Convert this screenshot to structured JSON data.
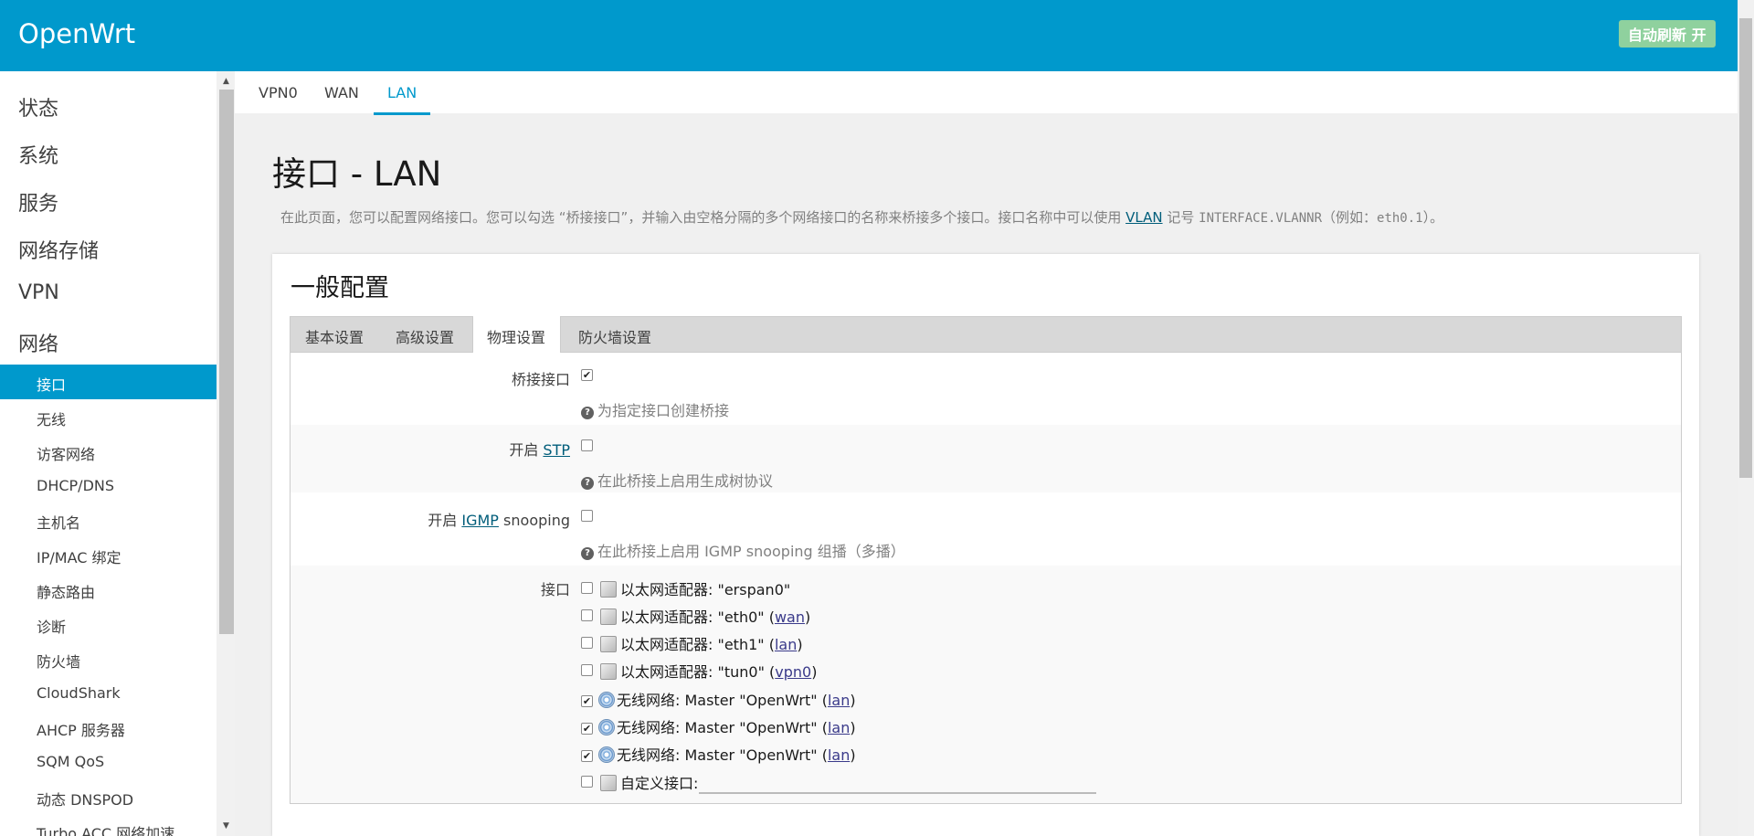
{
  "header": {
    "brand": "OpenWrt",
    "refresh_label": "自动刷新 开"
  },
  "sidebar": {
    "menus": [
      "状态",
      "系统",
      "服务",
      "网络存储",
      "VPN",
      "网络"
    ],
    "sub_items": [
      "接口",
      "无线",
      "访客网络",
      "DHCP/DNS",
      "主机名",
      "IP/MAC 绑定",
      "静态路由",
      "诊断",
      "防火墙",
      "CloudShark",
      "AHCP 服务器",
      "SQM QoS",
      "动态 DNSPOD",
      "Turbo ACC 网络加速"
    ],
    "active": "接口"
  },
  "iface_tabs": {
    "items": [
      "VPN0",
      "WAN",
      "LAN"
    ],
    "active": "LAN"
  },
  "page": {
    "title": "接口 - LAN",
    "desc_before": "在此页面，您可以配置网络接口。您可以勾选 “桥接接口”，并输入由空格分隔的多个网络接口的名称来桥接多个接口。接口名称中可以使用",
    "desc_link": "VLAN",
    "desc_mid": "记号",
    "desc_code": "INTERFACE.VLANNR",
    "desc_example_pre": "（例如：",
    "desc_example_code": "eth0.1",
    "desc_example_post": "）。"
  },
  "section": {
    "title": "一般配置",
    "tabs": [
      "基本设置",
      "高级设置",
      "物理设置",
      "防火墙设置"
    ],
    "active_tab": "物理设置"
  },
  "form": {
    "bridge": {
      "label": "桥接接口",
      "checked": true,
      "hint": "为指定接口创建桥接"
    },
    "stp": {
      "label_pre": "开启",
      "label_link": "STP",
      "checked": false,
      "hint": "在此桥接上启用生成树协议"
    },
    "igmp": {
      "label_pre": "开启",
      "label_link": "IGMP",
      "label_post": "snooping",
      "checked": false,
      "hint": "在此桥接上启用 IGMP snooping 组播（多播）"
    },
    "interfaces_label": "接口",
    "interfaces": [
      {
        "type": "eth",
        "text": "以太网适配器: \"erspan0\"",
        "net": "",
        "checked": false
      },
      {
        "type": "eth",
        "text": "以太网适配器: \"eth0\"",
        "net": "wan",
        "checked": false
      },
      {
        "type": "eth",
        "text": "以太网适配器: \"eth1\"",
        "net": "lan",
        "checked": false
      },
      {
        "type": "eth",
        "text": "以太网适配器: \"tun0\"",
        "net": "vpn0",
        "checked": false
      },
      {
        "type": "wifi",
        "text": "无线网络: Master \"OpenWrt\"",
        "net": "lan",
        "checked": true
      },
      {
        "type": "wifi",
        "text": "无线网络: Master \"OpenWrt\"",
        "net": "lan",
        "checked": true
      },
      {
        "type": "wifi",
        "text": "无线网络: Master \"OpenWrt\"",
        "net": "lan",
        "checked": true
      },
      {
        "type": "custom",
        "text": "自定义接口:",
        "net": "",
        "checked": false
      }
    ],
    "custom_value": ""
  }
}
